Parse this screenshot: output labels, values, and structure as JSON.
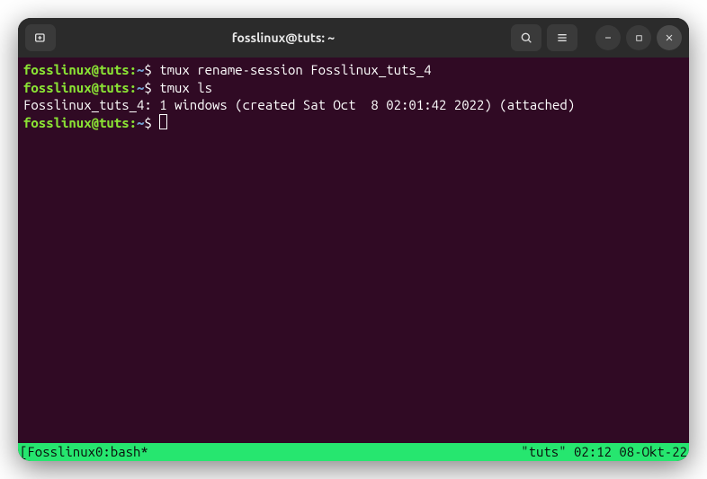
{
  "titlebar": {
    "title": "fosslinux@tuts: ~"
  },
  "terminal": {
    "lines": [
      {
        "prompt_user": "fosslinux@tuts",
        "prompt_path": "~",
        "prompt_dollar": "$",
        "command": "tmux rename-session Fosslinux_tuts_4"
      },
      {
        "prompt_user": "fosslinux@tuts",
        "prompt_path": "~",
        "prompt_dollar": "$",
        "command": "tmux ls"
      },
      {
        "output": "Fosslinux_tuts_4: 1 windows (created Sat Oct  8 02:01:42 2022) (attached)"
      },
      {
        "prompt_user": "fosslinux@tuts",
        "prompt_path": "~",
        "prompt_dollar": "$",
        "command": ""
      }
    ]
  },
  "tmux": {
    "left": "[Fosslinux0:bash*",
    "right": "\"tuts\" 02:12 08-Okt-22"
  }
}
